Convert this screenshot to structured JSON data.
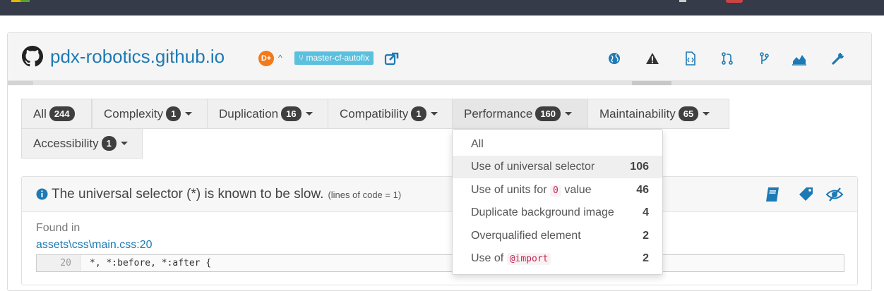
{
  "repo": {
    "name": "pdx-robotics.github.io",
    "grade": "D+",
    "branch": "master-cf-autofix"
  },
  "header_icons": [
    "globe-icon",
    "warning-icon",
    "code-file-icon",
    "pull-request-icon",
    "branch-icon",
    "area-chart-icon",
    "wrench-icon"
  ],
  "tabs": [
    {
      "label": "All",
      "count": "244"
    },
    {
      "label": "Complexity",
      "count": "1"
    },
    {
      "label": "Duplication",
      "count": "16"
    },
    {
      "label": "Compatibility",
      "count": "1"
    },
    {
      "label": "Performance",
      "count": "160"
    },
    {
      "label": "Maintainability",
      "count": "65"
    },
    {
      "label": "Accessibility",
      "count": "1"
    }
  ],
  "dropdown": {
    "items": [
      {
        "label": "All",
        "count": ""
      },
      {
        "label": "Use of universal selector",
        "count": "106"
      },
      {
        "pre": "Use of units for ",
        "code": "0",
        "post": " value",
        "count": "46"
      },
      {
        "label": "Duplicate background image",
        "count": "4"
      },
      {
        "label": "Overqualified element",
        "count": "2"
      },
      {
        "pre": "Use of ",
        "code": "@import",
        "post": "",
        "count": "2"
      }
    ]
  },
  "issue": {
    "title": "The universal selector (*) is known to be slow.",
    "meta": "(lines of code = 1)",
    "found_in_label": "Found in",
    "found_in_path": "assets\\css\\main.css:20",
    "line_number": "20",
    "code": "*, *:before, *:after {"
  },
  "colors": {
    "link": "#1d7ab5",
    "grade": "#f27a1b",
    "branch": "#5bc0de",
    "topbar": "#353b48"
  }
}
